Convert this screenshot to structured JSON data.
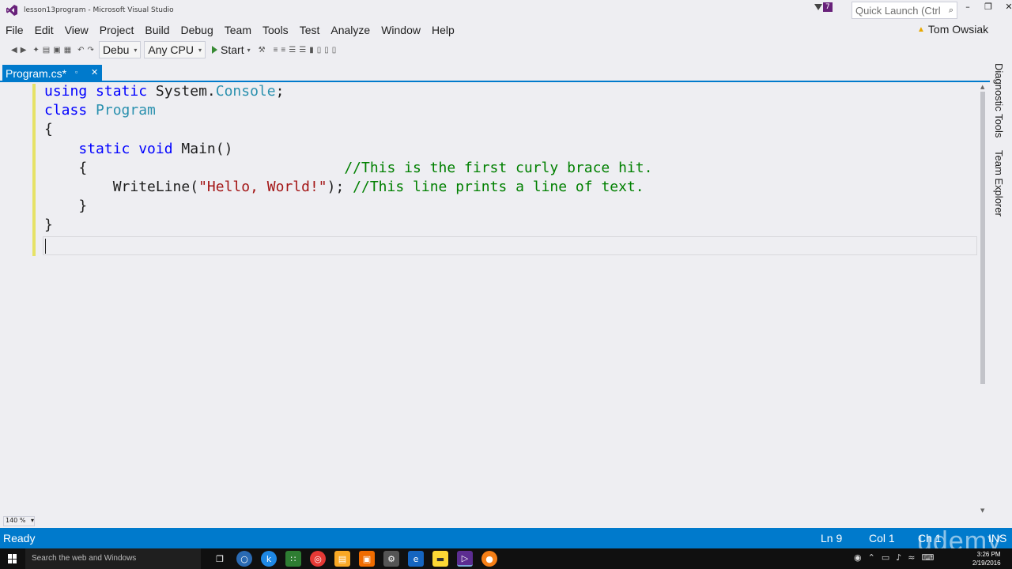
{
  "window": {
    "title": "lesson13program - Microsoft Visual Studio",
    "notification_count": "7",
    "quick_launch_placeholder": "Quick Launch (Ctrl"
  },
  "menu": [
    "File",
    "Edit",
    "View",
    "Project",
    "Build",
    "Debug",
    "Team",
    "Tools",
    "Test",
    "Analyze",
    "Window",
    "Help"
  ],
  "user": {
    "name": "Tom Owsiak"
  },
  "toolbar": {
    "config": "Debu",
    "platform": "Any CPU",
    "start_label": "Start"
  },
  "tab": {
    "label": "Program.cs*"
  },
  "code": {
    "l1_kw": "using static",
    "l1_ns": "System.",
    "l1_type": "Console",
    "l1_end": ";",
    "l2_kw": "class",
    "l2_type": "Program",
    "l3": "{",
    "l4_kw": "static void",
    "l4_rest": "Main()",
    "l5_brace": "{",
    "l5_cmt": "//This is the first curly brace hit.",
    "l6_call": "WriteLine(",
    "l6_str": "\"Hello, World!\"",
    "l6_end": ");",
    "l6_cmt": "//This line prints a line of text.",
    "l7": "}",
    "l8": "}"
  },
  "side_tabs": [
    "Diagnostic Tools",
    "Team Explorer"
  ],
  "zoom": "140 %",
  "status": {
    "state": "Ready",
    "line": "Ln 9",
    "col": "Col 1",
    "ch": "Ch 1",
    "mode": "INS"
  },
  "taskbar": {
    "search_placeholder": "Search the web and Windows",
    "time": "3:26 PM",
    "date": "2/19/2016"
  },
  "watermark": "udemy",
  "colors": {
    "accent": "#007acc",
    "keyword": "#0000ff",
    "type": "#2b91af",
    "string": "#a31515",
    "comment": "#008000"
  }
}
